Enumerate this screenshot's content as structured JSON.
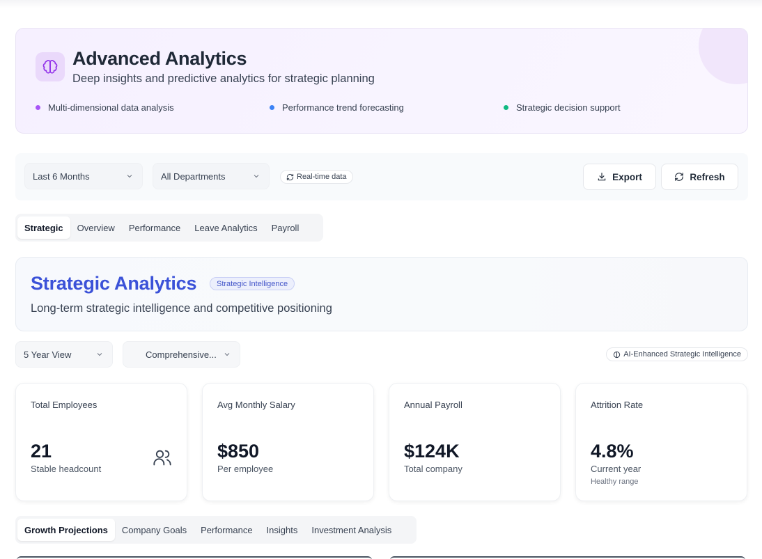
{
  "hero": {
    "title": "Advanced Analytics",
    "subtitle": "Deep insights and predictive analytics for strategic planning",
    "icon": "brain-icon",
    "features": [
      {
        "label": "Multi-dimensional data analysis",
        "color": "#a855f7"
      },
      {
        "label": "Performance trend forecasting",
        "color": "#3b82f6"
      },
      {
        "label": "Strategic decision support",
        "color": "#10b981"
      }
    ]
  },
  "filters": {
    "period": "Last 6 Months",
    "department": "All Departments",
    "realtime_label": "Real-time data",
    "export_label": "Export",
    "refresh_label": "Refresh"
  },
  "main_tabs": [
    "Strategic",
    "Overview",
    "Performance",
    "Leave Analytics",
    "Payroll"
  ],
  "strategic": {
    "title": "Strategic Analytics",
    "badge": "Strategic Intelligence",
    "subtitle": "Long-term strategic intelligence and competitive positioning",
    "view_select": "5 Year View",
    "scope_select": "Comprehensive...",
    "ai_label": "AI-Enhanced Strategic Intelligence"
  },
  "cards": [
    {
      "label": "Total Employees",
      "value": "21",
      "note": "Stable headcount",
      "icon": "users-icon"
    },
    {
      "label": "Avg Monthly Salary",
      "value": "$850",
      "note": "Per employee"
    },
    {
      "label": "Annual Payroll",
      "value": "$124K",
      "note": "Total company"
    },
    {
      "label": "Attrition Rate",
      "value": "4.8%",
      "note": "Current year",
      "note2": "Healthy range"
    }
  ],
  "sub_tabs": [
    "Growth Projections",
    "Company Goals",
    "Performance",
    "Insights",
    "Investment Analysis"
  ]
}
